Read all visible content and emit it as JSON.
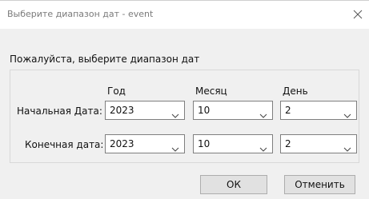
{
  "window": {
    "title": "Выберите диапазон дат - event"
  },
  "heading": "Пожалуйста, выберите диапазон дат",
  "columns": {
    "year": "Год",
    "month": "Месяц",
    "day": "День"
  },
  "rows": [
    {
      "label": "Начальная Дата:",
      "year": "2023",
      "month": "10",
      "day": "2"
    },
    {
      "label": "Конечная дата:",
      "year": "2023",
      "month": "10",
      "day": "2"
    }
  ],
  "buttons": {
    "ok": "ОК",
    "cancel": "Отменить"
  },
  "icons": {
    "close": "close-icon",
    "dropdown": "chevron-down-icon"
  }
}
